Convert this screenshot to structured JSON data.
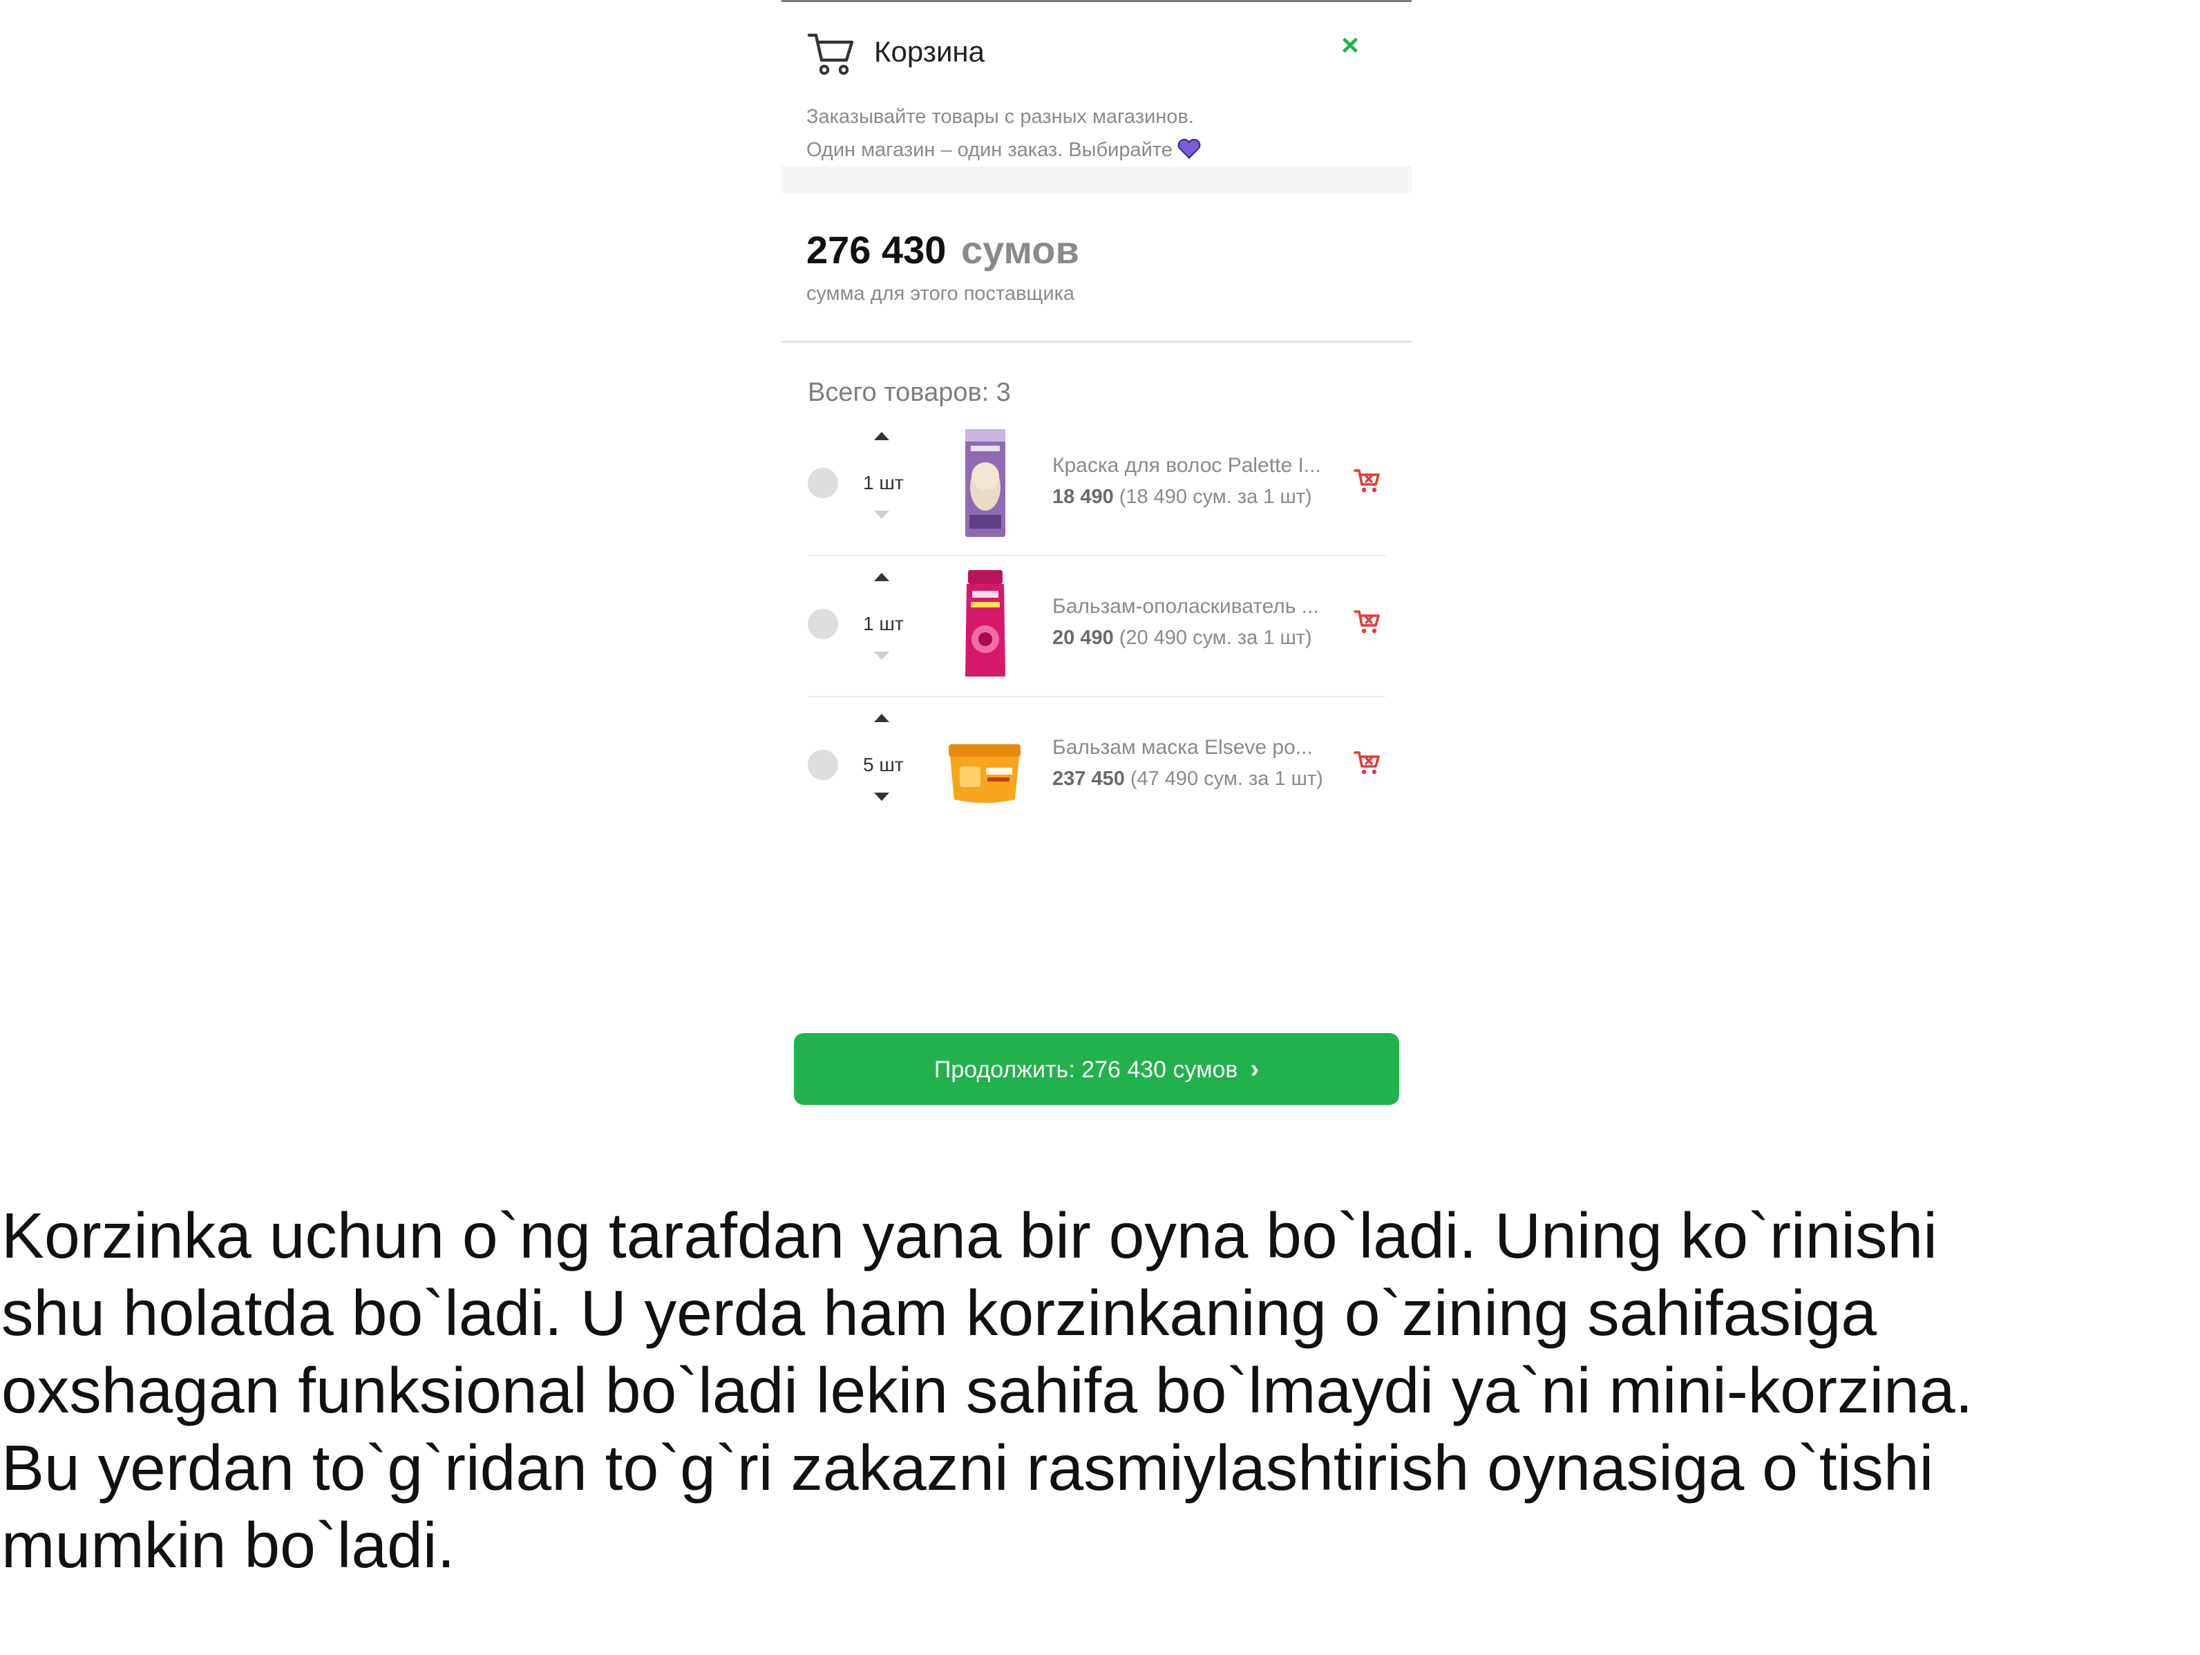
{
  "cart": {
    "title": "Корзина",
    "close_icon": "×",
    "hint_line1": "Заказывайте товары с разных магазинов.",
    "hint_line2": "Один магазин – один заказ. Выбирайте",
    "total_amount": "276 430",
    "total_currency": "сумов",
    "total_note": "сумма для этого поставщика",
    "items_count": "Всего товаров: 3",
    "items": [
      {
        "qty": "1 шт",
        "name": "Краска для волос Palette I...",
        "price_total": "18 490",
        "price_unit": "(18 490 сум. за 1 шт)"
      },
      {
        "qty": "1 шт",
        "name": "Бальзам-ополаскиватель ...",
        "price_total": "20 490",
        "price_unit": "(20 490 сум. за 1 шт)"
      },
      {
        "qty": "5 шт",
        "name": "Бальзам маска Elseve ро...",
        "price_total": "237 450",
        "price_unit": "(47 490 сум. за 1 шт)"
      }
    ],
    "checkout_label": "Продолжить: 276 430 сумов",
    "checkout_chevron": "›"
  },
  "caption": {
    "line1": "Korzinka uchun o`ng tarafdan yana bir oyna bo`ladi. Uning ko`rinishi",
    "line2": "shu holatda bo`ladi. U yerda ham korzinkaning o`zining sahifasiga",
    "line3": "oxshagan funksional bo`ladi lekin sahifa bo`lmaydi ya`ni mini-korzina.",
    "line4": "Bu yerdan to`g`ridan to`g`ri zakazni rasmiylashtirish oynasiga o`tishi",
    "line5": "mumkin bo`ladi."
  },
  "colors": {
    "accent_green": "#22b24c",
    "remove_red": "#e53935",
    "heart_purple": "#7b5bd6"
  },
  "icons": [
    "cart-icon",
    "close-icon",
    "heart-icon",
    "arrow-up-icon",
    "arrow-down-icon",
    "remove-from-cart-icon",
    "chevron-right-icon"
  ]
}
